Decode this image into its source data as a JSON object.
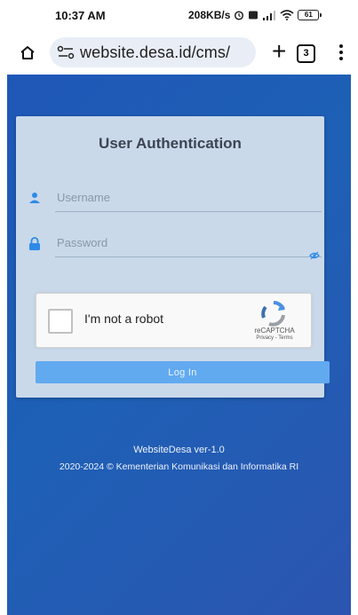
{
  "status_bar": {
    "time": "10:37 AM",
    "speed": "208KB/s",
    "battery": "61"
  },
  "browser": {
    "url": "website.desa.id/cms/",
    "tab_count": "3"
  },
  "login": {
    "title": "User Authentication",
    "username_placeholder": "Username",
    "password_placeholder": "Password",
    "login_button": "Log In"
  },
  "recaptcha": {
    "label": "I'm not a robot",
    "brand": "reCAPTCHA",
    "links": "Privacy - Terms"
  },
  "footer": {
    "version": "WebsiteDesa ver-1.0",
    "copyright": "2020-2024 © Kementerian Komunikasi dan Informatika RI"
  },
  "colors": {
    "page_background": "#1e5bb5",
    "card_background": "#c9d9ea",
    "accent_icon": "#2f8ae6",
    "login_button": "#62aaf0"
  },
  "icons": {
    "home": "home-icon",
    "site_info": "tune-icon",
    "new_tab": "plus-icon",
    "tabs": "tabs-icon",
    "menu": "more-vert-icon",
    "username": "user-icon",
    "password": "lock-icon",
    "show_password": "eye-off-icon",
    "recaptcha_logo": "recaptcha-icon"
  }
}
